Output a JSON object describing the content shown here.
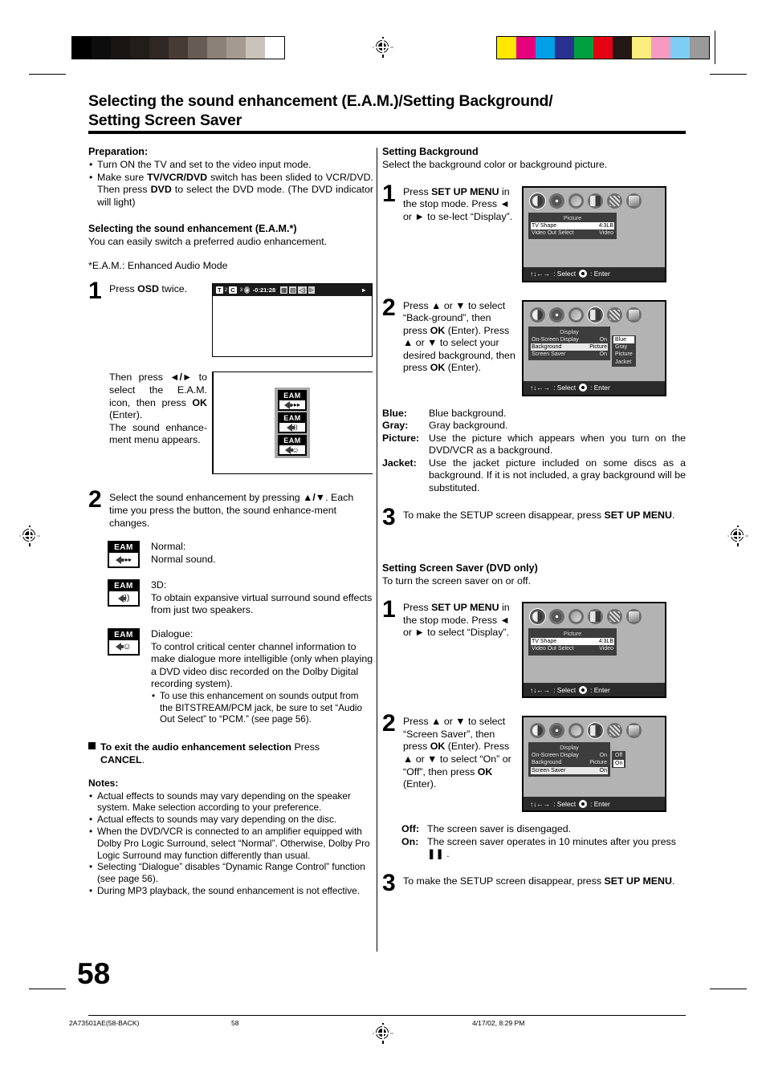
{
  "document": {
    "title_line1": "Selecting the sound enhancement (E.A.M.)/Setting Background/",
    "title_line2": "Setting Screen Saver",
    "page_number": "58"
  },
  "footer": {
    "doc_code": "2A73501AE(58-BACK)",
    "page": "58",
    "timestamp": "4/17/02, 8:29 PM"
  },
  "left_column": {
    "preparation": {
      "heading": "Preparation:",
      "items": [
        "Turn ON the TV and set to the video input mode.",
        "Make sure TV/VCR/DVD switch has been slided to VCR/DVD. Then press DVD to select the DVD mode. (The DVD indicator will light)"
      ],
      "item2_parts": {
        "a": "Make sure ",
        "b": "TV/VCR/DVD",
        "c": " switch has been slided to VCR/DVD. Then press ",
        "d": "DVD",
        "e": " to select the DVD mode. (The DVD indicator will light)"
      }
    },
    "section": {
      "heading": "Selecting the sound enhancement (E.A.M.*)",
      "intro": "You can easily switch a preferred audio enhancement.",
      "footnote": "*E.A.M.: Enhanced Audio Mode"
    },
    "step1": {
      "number": "1",
      "text_a": "Press ",
      "text_b": "OSD",
      "text_c": " twice.",
      "osd_bar": {
        "t": "T",
        "two": "2",
        "c": "C",
        "three": "3",
        "clock": "🕐",
        "time": "-0:21:28",
        "play": "►"
      },
      "followup_a": "Then press ",
      "followup_arrows": "◄/►",
      "followup_b": " to select the E.A.M. icon, then press ",
      "followup_ok": "OK",
      "followup_c": " (Enter).",
      "followup_d": "The sound enhance-ment menu appears."
    },
    "step2": {
      "number": "2",
      "text_a": "Select the sound enhancement by pressing ",
      "text_arrows": "▲/▼",
      "text_b": ". Each time you press the button, the sound enhance-ment changes.",
      "modes": [
        {
          "icon": "eam-normal-icon",
          "label": "Normal:",
          "desc": "Normal sound."
        },
        {
          "icon": "eam-3d-icon",
          "label": "3D:",
          "desc": "To obtain expansive virtual surround sound effects from just two speakers."
        },
        {
          "icon": "eam-dialogue-icon",
          "label": "Dialogue:",
          "desc": "To control critical center channel information to make dialogue more intelligible (only when playing a DVD video disc recorded on the Dolby Digital recording system)."
        }
      ],
      "dialogue_subbullet": "To use this enhancement on sounds output from the BITSTREAM/PCM jack, be sure to set “Audio Out Select” to “PCM.” (see page 56)."
    },
    "exit": {
      "bold": "To exit the audio enhancement selection",
      "rest": " Press ",
      "cancel": "CANCEL",
      "period": "."
    },
    "notes": {
      "heading": "Notes:",
      "items": [
        "Actual effects to sounds may vary depending on the speaker system.  Make selection according to your preference.",
        "Actual effects to sounds may vary depending on the disc.",
        "When the DVD/VCR is connected to an amplifier equipped with Dolby Pro Logic Surround, select “Normal”. Otherwise, Dolby Pro Logic Surround may function differently than usual.",
        "Selecting “Dialogue” disables “Dynamic Range Control” function (see page 56).",
        "During MP3 playback, the sound enhancement is not effective."
      ]
    }
  },
  "right_column": {
    "background": {
      "heading": "Setting Background",
      "intro": "Select the background color or background picture.",
      "step1": {
        "number": "1",
        "a": "Press ",
        "b": "SET UP MENU",
        "c": " in the stop mode. Press ",
        "arrow_left": "◄",
        "or": " or ",
        "arrow_right": "►",
        "d": " to se-lect “Display”."
      },
      "step2": {
        "number": "2",
        "a": "Press ",
        "up": "▲",
        "or": " or ",
        "down": "▼",
        "b": " to select “Back-ground”, then press ",
        "ok": "OK",
        "c": " (Enter). Press ",
        "d": " to select your desired background, then press ",
        "e": " (Enter)."
      },
      "definitions": [
        {
          "key": "Blue:",
          "value": "Blue background."
        },
        {
          "key": "Gray:",
          "value": "Gray background."
        },
        {
          "key": "Picture:",
          "value": "Use the picture which appears when you turn on the DVD/VCR as a background."
        },
        {
          "key": "Jacket:",
          "value": "Use the jacket picture included on some discs as a background. If it is not included, a gray background will be substituted."
        }
      ],
      "step3": {
        "number": "3",
        "a": "To make the SETUP screen disappear, press ",
        "b": "SET UP MENU",
        "c": "."
      }
    },
    "screensaver": {
      "heading": "Setting Screen Saver (DVD only)",
      "intro": "To turn the screen saver on or off.",
      "step1": {
        "number": "1",
        "a": "Press ",
        "b": "SET UP MENU",
        "c": " in the stop mode. Press ",
        "arrow_left": "◄",
        "or": " or ",
        "arrow_right": "►",
        "d": " to select “Display”."
      },
      "step2": {
        "number": "2",
        "a": "Press ",
        "up": "▲",
        "or": " or ",
        "down": "▼",
        "b": " to select “Screen Saver”, then press ",
        "ok": "OK",
        "c": " (Enter). Press ",
        "d": " to select “On” or “Off”, then press ",
        "e": " (Enter)."
      },
      "definitions": [
        {
          "key": "Off:",
          "value": "The screen saver is disengaged."
        },
        {
          "key": "On:",
          "value": "The screen saver operates in 10 minutes after you press ❚❚ ."
        }
      ],
      "step3": {
        "number": "3",
        "a": "To make the SETUP screen disappear, press ",
        "b": "SET UP MENU",
        "c": "."
      }
    }
  },
  "setup_menu_picture": {
    "menu_title": "Picture",
    "rows": [
      {
        "label": "TV Shape",
        "value": "4:3LB",
        "highlight": true
      },
      {
        "label": "Video Out Select",
        "value": "Video",
        "highlight": false
      }
    ],
    "footer_select": ": Select",
    "footer_enter": ": Enter",
    "footer_arrows": "↑↓←→"
  },
  "setup_menu_display_background": {
    "menu_title": "Display",
    "rows": [
      {
        "label": "On-Screen Display",
        "value": "On",
        "highlight": false
      },
      {
        "label": "Background",
        "value": "Picture",
        "highlight": true
      },
      {
        "label": "Screen Saver",
        "value": "On",
        "highlight": false
      }
    ],
    "submenu": [
      "Blue",
      "Gray",
      "Picture",
      "Jacket"
    ],
    "submenu_selected": "Blue",
    "footer_select": ": Select",
    "footer_enter": ": Enter",
    "footer_arrows": "↑↓←→"
  },
  "setup_menu_display_saver": {
    "menu_title": "Display",
    "rows": [
      {
        "label": "On-Screen Display",
        "value": "On",
        "highlight": false
      },
      {
        "label": "Background",
        "value": "Picture",
        "highlight": false
      },
      {
        "label": "Screen Saver",
        "value": "On",
        "highlight": true
      }
    ],
    "submenu": [
      "Off",
      "On"
    ],
    "submenu_selected": "On",
    "footer_select": ": Select",
    "footer_enter": ": Enter",
    "footer_arrows": "↑↓←→"
  },
  "colors": {
    "gray_ramp": [
      "#000000",
      "#0d0d0d",
      "#1a1512",
      "#231d19",
      "#2f2823",
      "#473c35",
      "#675c55",
      "#8c8179",
      "#a49a92",
      "#cac3bb",
      "#ffffff"
    ],
    "color_bar": [
      "#ffe800",
      "#e6007e",
      "#00a0e9",
      "#2b3190",
      "#00a040",
      "#e60012",
      "#231815",
      "#faee7d",
      "#f59bc1",
      "#7ecef4",
      "#9a9a9a"
    ]
  }
}
